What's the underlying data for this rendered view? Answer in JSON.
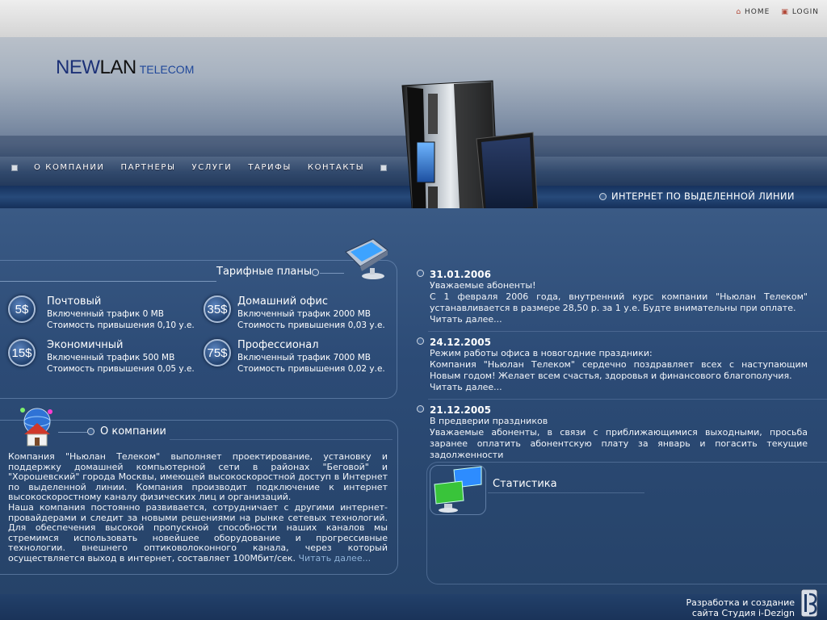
{
  "top_links": [
    {
      "label": "HOME",
      "icon": "home-icon"
    },
    {
      "label": "LOGIN",
      "icon": "lock-icon"
    }
  ],
  "logo": {
    "part1": "NEW",
    "part2": "LAN",
    "part3": "TELECOM"
  },
  "nav": [
    "О КОМПАНИИ",
    "ПАРТНЕРЫ",
    "УСЛУГИ",
    "ТАРИФЫ",
    "КОНТАКТЫ"
  ],
  "hero_text": "ИНТЕРНЕТ ПО ВЫДЕЛЕННОЙ ЛИНИИ",
  "tariffs": {
    "title": "Тарифные планы",
    "items": [
      {
        "price": "5$",
        "name": "Почтовый",
        "line1": "Включенный трафик 0 MB",
        "line2": "Стоимость привышения 0,10 у.е."
      },
      {
        "price": "35$",
        "name": "Домашний офис",
        "line1": "Включенный трафик 2000 MB",
        "line2": "Стоимость привышения 0,03 у.е."
      },
      {
        "price": "15$",
        "name": "Экономичный",
        "line1": "Включенный трафик 500 MB",
        "line2": "Стоимость привышения 0,05 у.е."
      },
      {
        "price": "75$",
        "name": "Профессионал",
        "line1": "Включенный трафик 7000 MB",
        "line2": "Стоимость привышения 0,02 у.е."
      }
    ]
  },
  "about": {
    "title": "О компании",
    "text": "Компания \"Ньюлан Телеком\" выполняет проектирование, установку и поддержку домашней компьютерной сети в районах \"Беговой\" и \"Хорошевский\" города Москвы, имеющей высокоскоростной доступ в Интернет по выделенной линии. Компания производит подключение к интернет высокоскоростному каналу физических лиц и организаций.",
    "text2": "Наша компания постоянно развивается, сотрудничает с другими интернет-провайдерами и следит за новыми решениями на рынке сетевых технологий. Для обеспечения высокой пропускной способности наших каналов мы стремимся использовать новейшее оборудование и прогрессивные технологии. внешнего оптиковолоконного канала, через который осуществляется выход в интернет, составляет 100Мбит/сек.",
    "more": "Читать далее..."
  },
  "news": [
    {
      "date": "31.01.2006",
      "title": "Уважаемые абоненты!",
      "body": "С 1 февраля 2006 года, внутренний курс компании \"Ньюлан Телеком\" устанавливается в размере 28,50 р. за 1 у.е. Будте внимательны при оплате.",
      "more": "Читать далее..."
    },
    {
      "date": "24.12.2005",
      "title": "Режим работы офиса в новогодние праздники:",
      "body": "Компания \"Ньюлан Телеком\" сердечно поздравляет всех с наступающим Новым годом! Желает всем счастья, здоровья и финансового благополучия.",
      "more": "Читать далее..."
    },
    {
      "date": "21.12.2005",
      "title": "В предверии праздников",
      "body": "Уважаемые абоненты, в связи с приближающимися выходными, просьба заранее оплатить абонентскую плату за январь и погасить текущие задолженности",
      "more": ""
    }
  ],
  "stats": {
    "title": "Статистика"
  },
  "footer": {
    "line1": "Разработка и создание",
    "line2": "сайта Студия i-Dezign"
  }
}
